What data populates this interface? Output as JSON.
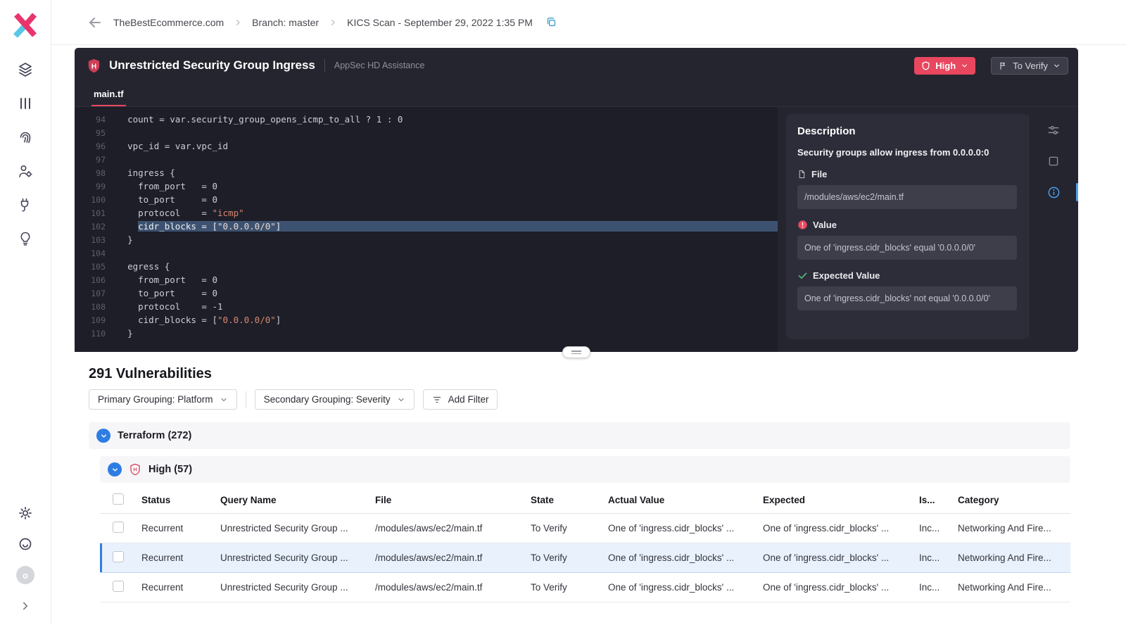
{
  "icons": {
    "high_letter": "H",
    "avatar_letter": "o"
  },
  "breadcrumb": {
    "items": [
      "TheBestEcommerce.com",
      "Branch: master",
      "KICS Scan - September 29, 2022 1:35 PM"
    ]
  },
  "finding": {
    "title": "Unrestricted Security Group Ingress",
    "subtitle": "AppSec HD Assistance",
    "severity_label": "High",
    "state_label": "To Verify",
    "tab": "main.tf",
    "code": {
      "highlight_line": 102,
      "lines": [
        {
          "n": 94,
          "c": "  count = var.security_group_opens_icmp_to_all ? 1 : 0"
        },
        {
          "n": 95,
          "c": ""
        },
        {
          "n": 96,
          "c": "  vpc_id = var.vpc_id"
        },
        {
          "n": 97,
          "c": ""
        },
        {
          "n": 98,
          "c": "  ingress {"
        },
        {
          "n": 99,
          "c": "    from_port   = 0"
        },
        {
          "n": 100,
          "c": "    to_port     = 0"
        },
        {
          "n": 101,
          "c": "    protocol    = \"icmp\""
        },
        {
          "n": 102,
          "c": "    cidr_blocks = [\"0.0.0.0/0\"]"
        },
        {
          "n": 103,
          "c": "  }"
        },
        {
          "n": 104,
          "c": ""
        },
        {
          "n": 105,
          "c": "  egress {"
        },
        {
          "n": 106,
          "c": "    from_port   = 0"
        },
        {
          "n": 107,
          "c": "    to_port     = 0"
        },
        {
          "n": 108,
          "c": "    protocol    = -1"
        },
        {
          "n": 109,
          "c": "    cidr_blocks = [\"0.0.0.0/0\"]"
        },
        {
          "n": 110,
          "c": "  }"
        }
      ]
    },
    "description": {
      "title": "Description",
      "summary": "Security groups allow ingress from 0.0.0.0:0",
      "file_label": "File",
      "file_value": "/modules/aws/ec2/main.tf",
      "value_label": "Value",
      "value_text": "One of 'ingress.cidr_blocks' equal '0.0.0.0/0'",
      "expected_label": "Expected Value",
      "expected_text": "One of 'ingress.cidr_blocks' not equal '0.0.0.0/0'"
    }
  },
  "vulnerabilities": {
    "heading": "291 Vulnerabilities",
    "primary_grouping": "Primary Grouping: Platform",
    "secondary_grouping": "Secondary Grouping: Severity",
    "add_filter": "Add Filter",
    "platform_group": "Terraform (272)",
    "severity_group": "High (57)",
    "columns": [
      "Status",
      "Query Name",
      "File",
      "State",
      "Actual Value",
      "Expected",
      "Is...",
      "Category"
    ],
    "selected_row": 1,
    "rows": [
      {
        "status": "Recurrent",
        "query_name": "Unrestricted Security Group ...",
        "file": "/modules/aws/ec2/main.tf",
        "state": "To Verify",
        "actual_value": "One of 'ingress.cidr_blocks' ...",
        "expected": "One of 'ingress.cidr_blocks' ...",
        "issue": "Inc...",
        "category": "Networking And Fire..."
      },
      {
        "status": "Recurrent",
        "query_name": "Unrestricted Security Group ...",
        "file": "/modules/aws/ec2/main.tf",
        "state": "To Verify",
        "actual_value": "One of 'ingress.cidr_blocks' ...",
        "expected": "One of 'ingress.cidr_blocks' ...",
        "issue": "Inc...",
        "category": "Networking And Fire..."
      },
      {
        "status": "Recurrent",
        "query_name": "Unrestricted Security Group ...",
        "file": "/modules/aws/ec2/main.tf",
        "state": "To Verify",
        "actual_value": "One of 'ingress.cidr_blocks' ...",
        "expected": "One of 'ingress.cidr_blocks' ...",
        "issue": "Inc...",
        "category": "Networking And Fire..."
      }
    ]
  }
}
